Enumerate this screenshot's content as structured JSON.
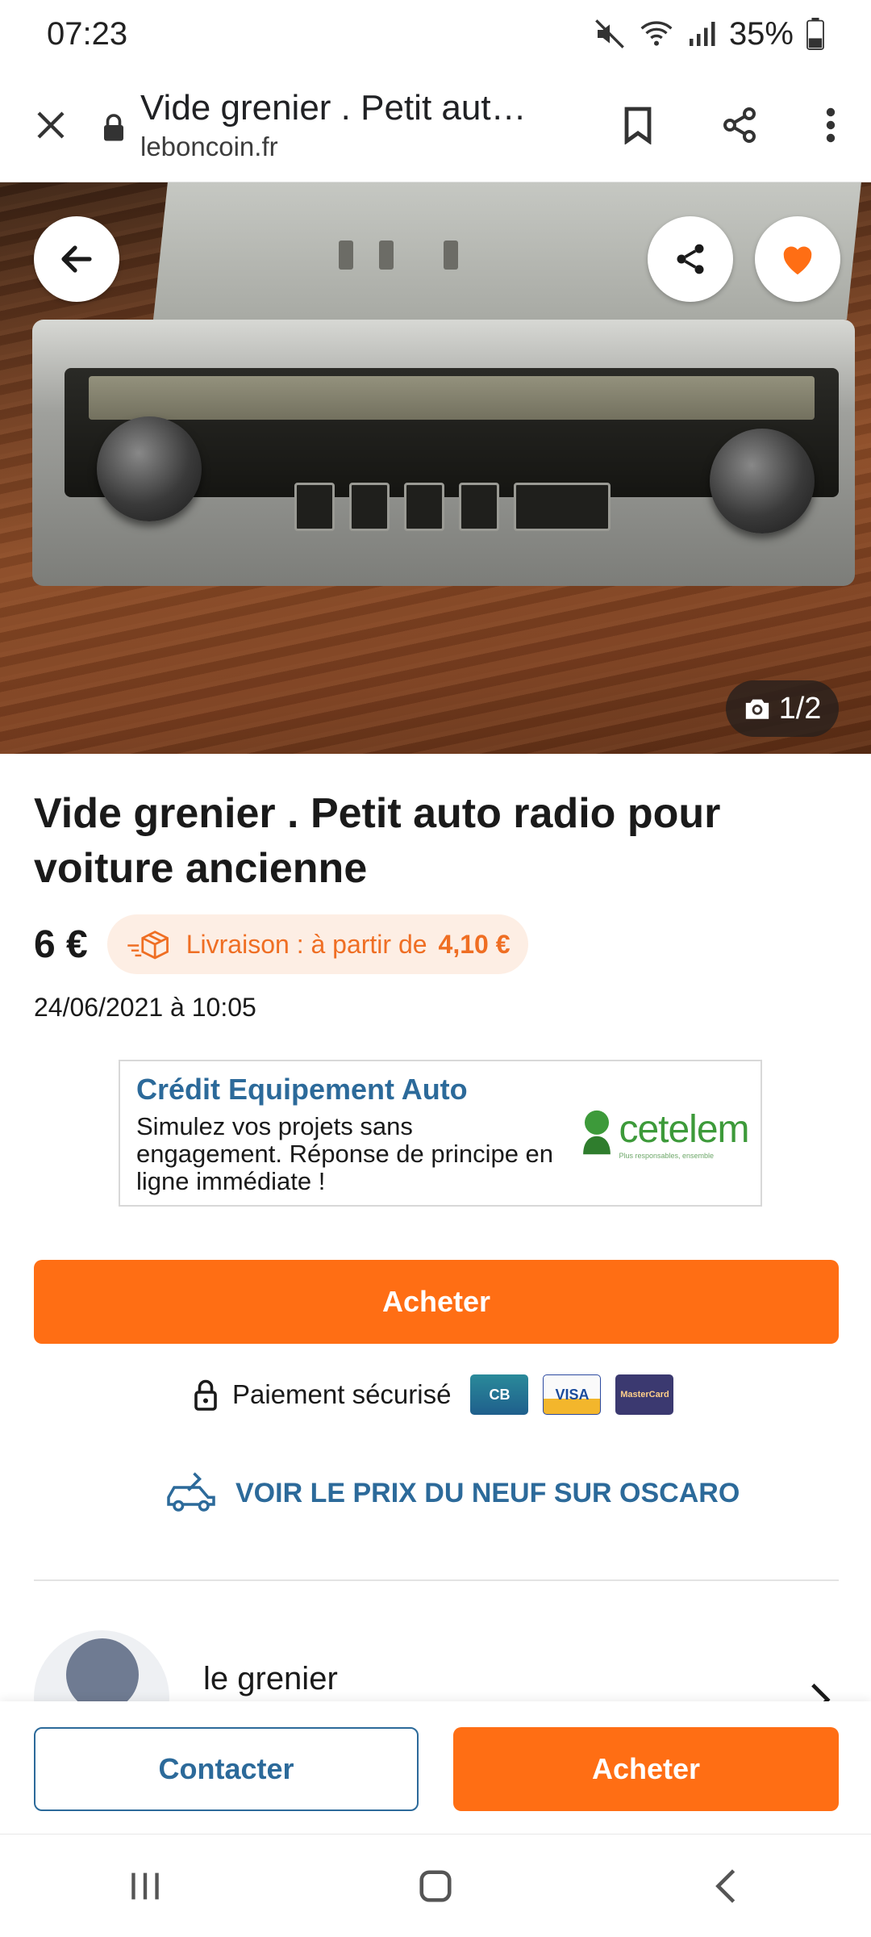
{
  "status_bar": {
    "time": "07:23",
    "battery": "35%"
  },
  "browser": {
    "page_title": "Vide grenier . Petit aut…",
    "url": "leboncoin.fr"
  },
  "hero": {
    "photo_counter": "1/2"
  },
  "ad": {
    "title": "Vide grenier . Petit auto radio pour voiture ancienne",
    "price": "6 €",
    "delivery_label": "Livraison : à partir de",
    "delivery_price": "4,10 €",
    "date": "24/06/2021 à 10:05"
  },
  "promo": {
    "title": "Crédit Equipement Auto",
    "body": "Simulez vos projets sans engagement. Réponse de principe en ligne immédiate !",
    "brand": "cetelem",
    "brand_tagline": "Plus responsables, ensemble"
  },
  "actions": {
    "buy_label": "Acheter",
    "secure_payment": "Paiement sécurisé",
    "card_cb": "CB",
    "card_visa": "VISA",
    "card_mc": "MasterCard",
    "oscaro_link": "VOIR LE PRIX DU NEUF SUR OSCARO"
  },
  "seller": {
    "name": "le grenier"
  },
  "bottom_bar": {
    "contact_label": "Contacter",
    "buy_label": "Acheter"
  },
  "colors": {
    "accent_orange": "#ff6e14",
    "link_blue": "#2c6a9a",
    "chip_bg": "#fdeee4"
  },
  "icons": [
    "close-icon",
    "lock-icon",
    "bookmark-icon",
    "share-icon",
    "more-vert-icon",
    "back-arrow-icon",
    "heart-icon",
    "camera-icon",
    "delivery-box-icon",
    "padlock-icon",
    "car-icon",
    "chevron-right-icon",
    "recents-icon",
    "home-icon",
    "nav-back-icon"
  ]
}
